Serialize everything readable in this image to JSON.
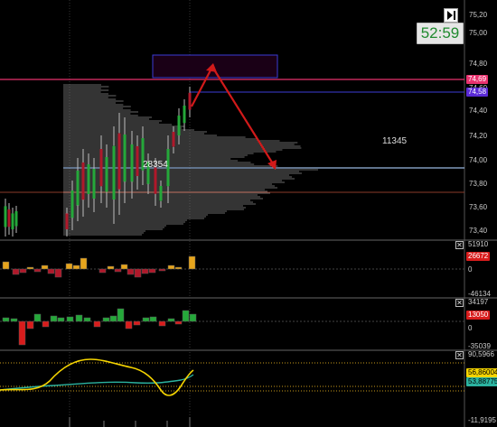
{
  "timer": "52:59",
  "price_axis": {
    "labels": [
      "75,20",
      "75,00",
      "74,80",
      "74,60",
      "74,40",
      "74,20",
      "74,00",
      "73,80",
      "73,60",
      "73,40"
    ],
    "current_tag": "74,69",
    "current_tag_color": "#e8326e",
    "box_tag": "74,58",
    "box_tag_color": "#5a2ad6"
  },
  "annotations": {
    "profile_volume_left": "28354",
    "profile_volume_right": "11345"
  },
  "panel1": {
    "top": "51910",
    "zero": "0",
    "bottom": "-46134",
    "tag": "26672",
    "tag_color": "#d81c1c"
  },
  "panel2": {
    "top": "34197",
    "zero": "0",
    "bottom": "-35039",
    "tag": "13050",
    "tag_color": "#d81c1c"
  },
  "panel3": {
    "top": "90,5966",
    "tag_yellow": "56,86004",
    "tag_teal": "53,88775",
    "bottom": "-11,9195"
  },
  "colors": {
    "up_bar": "#e7a51d",
    "down_bar": "#b0182a",
    "green_bar": "#25a83a",
    "red_bar": "#d81c1c",
    "oscillator_line": "#f5d400",
    "signal_line": "#2bb3a0",
    "arrow": "#d11a1a",
    "zone_border": "#3b3bd6",
    "profile": "#7c7c7c"
  }
}
